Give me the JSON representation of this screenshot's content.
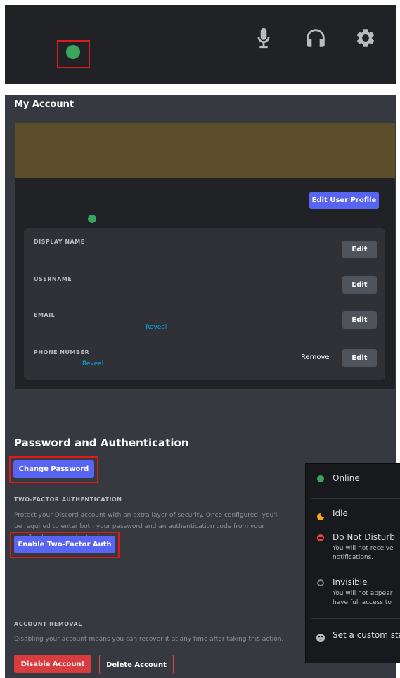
{
  "topbar": {
    "status_dot_color": "#3ba55d",
    "icons": [
      "microphone-icon",
      "headphones-icon",
      "gear-icon"
    ]
  },
  "account": {
    "title": "My Account",
    "edit_profile_label": "Edit User Profile",
    "fields": [
      {
        "label": "DISPLAY NAME",
        "edit_label": "Edit"
      },
      {
        "label": "USERNAME",
        "edit_label": "Edit"
      },
      {
        "label": "EMAIL",
        "reveal_label": "Reveal",
        "edit_label": "Edit"
      },
      {
        "label": "PHONE NUMBER",
        "reveal_label": "Reveal",
        "remove_label": "Remove",
        "edit_label": "Edit"
      }
    ]
  },
  "password": {
    "title": "Password and Authentication",
    "change_password_label": "Change Password",
    "twofa_label": "TWO-FACTOR AUTHENTICATION",
    "twofa_description": [
      "Protect your Discord account with an extra layer of security. Once configured, you'll",
      "be required to enter both your password and an authentication code from your",
      "mobile phone in order to sign in"
    ],
    "enable_twofa_label": "Enable Two-Factor Auth"
  },
  "removal": {
    "label": "ACCOUNT REMOVAL",
    "description": "Disabling your account means you can recover it at any time after taking this action.",
    "disable_label": "Disable Account",
    "delete_label": "Delete Account"
  },
  "status_menu": {
    "items": [
      {
        "label": "Online",
        "icon": "online-status-icon",
        "color": "#3ba55d"
      },
      {
        "label": "Idle",
        "icon": "idle-moon-icon",
        "color": "#faa61a"
      },
      {
        "label": "Do Not Disturb",
        "icon": "dnd-status-icon",
        "color": "#ed4245",
        "desc": [
          "You will not receive",
          "notifications."
        ]
      },
      {
        "label": "Invisible",
        "icon": "invisible-status-icon",
        "color": "#747f8d",
        "desc": [
          "You will not appear",
          "have full access to"
        ]
      },
      {
        "label": "Set a custom sta",
        "icon": "smiley-icon"
      }
    ]
  }
}
